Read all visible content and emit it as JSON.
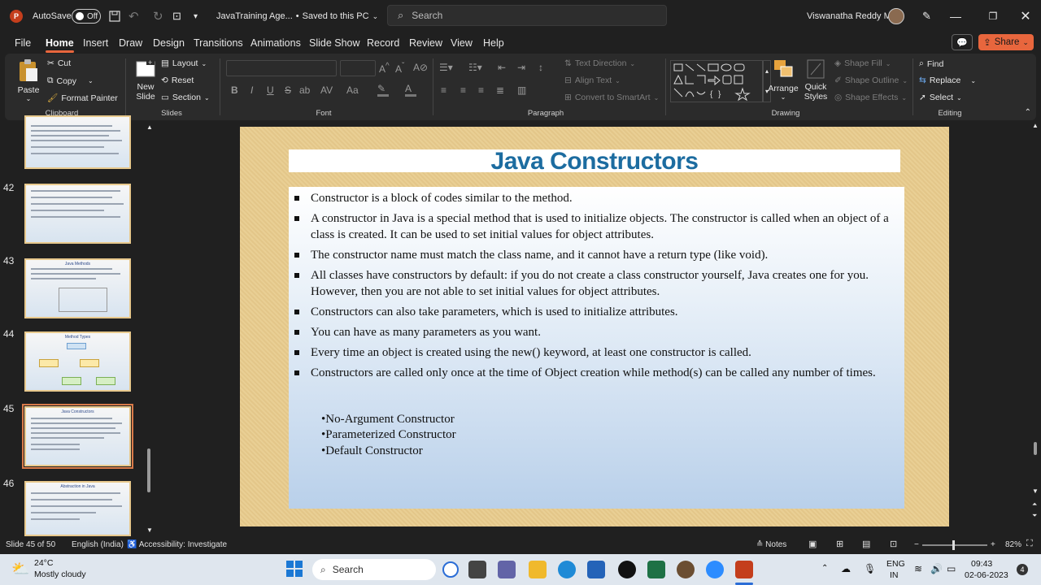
{
  "titlebar": {
    "autosave_label": "AutoSave",
    "autosave_state": "Off",
    "doc_title": "JavaTraining Age...",
    "save_status": "Saved to this PC",
    "search_placeholder": "Search",
    "user_name": "Viswanatha Reddy M"
  },
  "menu": {
    "tabs": [
      "File",
      "Home",
      "Insert",
      "Draw",
      "Design",
      "Transitions",
      "Animations",
      "Slide Show",
      "Record",
      "Review",
      "View",
      "Help"
    ],
    "active": "Home",
    "share_label": "Share"
  },
  "ribbon": {
    "clipboard": {
      "paste": "Paste",
      "cut": "Cut",
      "copy": "Copy",
      "format_painter": "Format Painter",
      "label": "Clipboard"
    },
    "slides": {
      "new_slide": "New Slide",
      "layout": "Layout",
      "reset": "Reset",
      "section": "Section",
      "label": "Slides"
    },
    "font": {
      "label": "Font",
      "bold": "B",
      "italic": "I",
      "underline": "U",
      "strike": "S",
      "shadow": "ab",
      "spacing": "AV",
      "case": "Aa"
    },
    "paragraph": {
      "text_direction": "Text Direction",
      "align_text": "Align Text",
      "convert_smartart": "Convert to SmartArt",
      "label": "Paragraph"
    },
    "drawing": {
      "arrange": "Arrange",
      "quick_styles": "Quick Styles",
      "shape_fill": "Shape Fill",
      "shape_outline": "Shape Outline",
      "shape_effects": "Shape Effects",
      "label": "Drawing"
    },
    "editing": {
      "find": "Find",
      "replace": "Replace",
      "select": "Select",
      "label": "Editing"
    }
  },
  "thumbnails": [
    {
      "num": "",
      "title": ""
    },
    {
      "num": "42",
      "title": ""
    },
    {
      "num": "43",
      "title": "Java Methods"
    },
    {
      "num": "44",
      "title": "Method Types"
    },
    {
      "num": "45",
      "title": "Java Constructors"
    },
    {
      "num": "46",
      "title": "Abstraction in Java"
    }
  ],
  "slide": {
    "title": "Java Constructors",
    "bullets": [
      "Constructor is a block of codes similar to the method.",
      "A constructor in Java is a special method that is used to initialize objects. The constructor is called when an object of a class is created. It can be used to set initial values for object attributes.",
      "The constructor name must match the class name, and it cannot have a return type (like void).",
      "All classes have constructors by default: if you do not create a class constructor yourself, Java creates one for you. However, then you are not able to set initial values for object attributes.",
      "Constructors can also take parameters, which is used to initialize attributes.",
      "You can have as many parameters as you want.",
      "Every time an object is created using the new() keyword, at least one constructor is called.",
      "Constructors are called only once at the time of Object creation while method(s) can be called any number of times."
    ],
    "sub_items": [
      "•No-Argument Constructor",
      "•Parameterized Constructor",
      "•Default Constructor"
    ]
  },
  "status": {
    "slide_info": "Slide 45 of 50",
    "language": "English (India)",
    "accessibility": "Accessibility: Investigate",
    "notes": "Notes",
    "zoom": "82%",
    "zoom_level": 0.82
  },
  "taskbar": {
    "weather_temp": "24°C",
    "weather_desc": "Mostly cloudy",
    "search": "Search",
    "lang_top": "ENG",
    "lang_bottom": "IN",
    "time": "09:43",
    "date": "02-06-2023",
    "notif_count": "4"
  },
  "colors": {
    "accent": "#e8663d",
    "title": "#1c6ca0",
    "slide_bg": "#e9cf94"
  }
}
